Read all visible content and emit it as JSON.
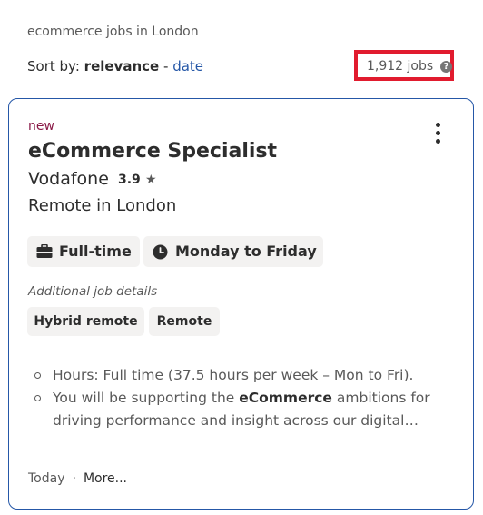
{
  "header": {
    "breadcrumb": "ecommerce jobs in London",
    "sort_prefix": "Sort by:",
    "sort_active": "relevance",
    "sort_separator": "-",
    "sort_alt": "date",
    "job_count": "1,912 jobs",
    "help_glyph": "?"
  },
  "job": {
    "badge": "new",
    "title": "eCommerce Specialist",
    "company": "Vodafone",
    "rating": "3.9",
    "star": "★",
    "location": "Remote in London",
    "tags": [
      "Full-time",
      "Monday to Friday"
    ],
    "tag_icons": [
      "briefcase-icon",
      "clock-icon"
    ],
    "additional_label": "Additional job details",
    "details": [
      "Hybrid remote",
      "Remote"
    ],
    "snippet": {
      "bullet1": "Hours: Full time (37.5 hours per week – Mon to Fri).",
      "bullet2_pre": "You will be supporting the ",
      "bullet2_bold": "eCommerce",
      "bullet2_post": " ambitions for driving performance and insight across our digital…"
    },
    "posted": "Today",
    "footer_sep": "·",
    "more": "More..."
  },
  "colors": {
    "accent": "#2557a7",
    "highlight_box": "#e11b2e",
    "new_badge": "#8b1b48"
  }
}
